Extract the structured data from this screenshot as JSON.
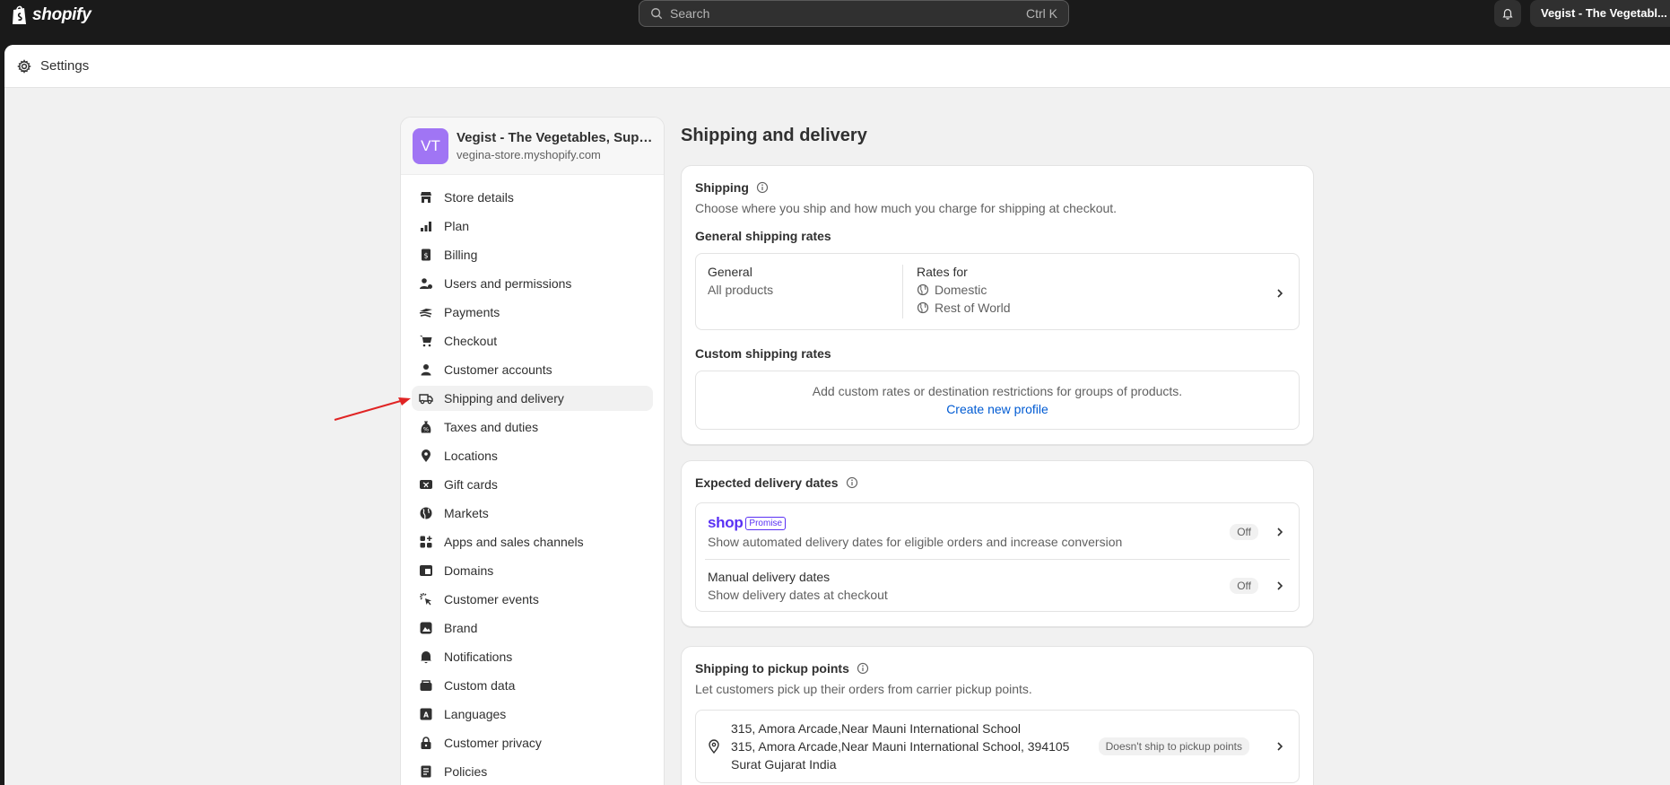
{
  "topbar": {
    "brand": "shopify",
    "search_placeholder": "Search",
    "search_shortcut": "Ctrl K",
    "store_button": "Vegist - The Vegetabl..."
  },
  "settings_bar": {
    "title": "Settings"
  },
  "sidebar": {
    "avatar_initials": "VT",
    "store_name": "Vegist - The Vegetables, Supermarket",
    "store_url": "vegina-store.myshopify.com",
    "items": [
      {
        "label": "Store details",
        "icon": "store-icon"
      },
      {
        "label": "Plan",
        "icon": "plan-icon"
      },
      {
        "label": "Billing",
        "icon": "billing-icon"
      },
      {
        "label": "Users and permissions",
        "icon": "users-icon"
      },
      {
        "label": "Payments",
        "icon": "payments-icon"
      },
      {
        "label": "Checkout",
        "icon": "cart-icon"
      },
      {
        "label": "Customer accounts",
        "icon": "person-icon"
      },
      {
        "label": "Shipping and delivery",
        "icon": "truck-icon",
        "active": true
      },
      {
        "label": "Taxes and duties",
        "icon": "tax-icon"
      },
      {
        "label": "Locations",
        "icon": "location-icon"
      },
      {
        "label": "Gift cards",
        "icon": "gift-card-icon"
      },
      {
        "label": "Markets",
        "icon": "globe-icon"
      },
      {
        "label": "Apps and sales channels",
        "icon": "apps-icon"
      },
      {
        "label": "Domains",
        "icon": "domain-icon"
      },
      {
        "label": "Customer events",
        "icon": "cursor-icon"
      },
      {
        "label": "Brand",
        "icon": "brand-icon"
      },
      {
        "label": "Notifications",
        "icon": "bell-icon"
      },
      {
        "label": "Custom data",
        "icon": "data-icon"
      },
      {
        "label": "Languages",
        "icon": "language-icon"
      },
      {
        "label": "Customer privacy",
        "icon": "lock-icon"
      },
      {
        "label": "Policies",
        "icon": "policy-icon"
      }
    ]
  },
  "main": {
    "title": "Shipping and delivery",
    "shipping": {
      "title": "Shipping",
      "subtitle": "Choose where you ship and how much you charge for shipping at checkout.",
      "general_heading": "General shipping rates",
      "general_name": "General",
      "general_products": "All products",
      "rates_for": "Rates for",
      "zone_1": "Domestic",
      "zone_2": "Rest of World",
      "custom_heading": "Custom shipping rates",
      "custom_text": "Add custom rates or destination restrictions for groups of products.",
      "custom_link": "Create new profile"
    },
    "delivery": {
      "title": "Expected delivery dates",
      "shop_word": "shop",
      "promise_label": "Promise",
      "promise_desc": "Show automated delivery dates for eligible orders and increase conversion",
      "promise_status": "Off",
      "manual_title": "Manual delivery dates",
      "manual_desc": "Show delivery dates at checkout",
      "manual_status": "Off"
    },
    "pickup": {
      "title": "Shipping to pickup points",
      "subtitle": "Let customers pick up their orders from carrier pickup points.",
      "location_name": "315, Amora Arcade,Near Mauni International School",
      "location_address": "315, Amora Arcade,Near Mauni International School, 394105",
      "location_city": "Surat Gujarat India",
      "status": "Doesn't ship to pickup points"
    }
  },
  "colors": {
    "accent": "#005bd3",
    "shop_promise": "#5a31f4",
    "avatar": "#a075f4",
    "annotation_arrow": "#e02424"
  }
}
